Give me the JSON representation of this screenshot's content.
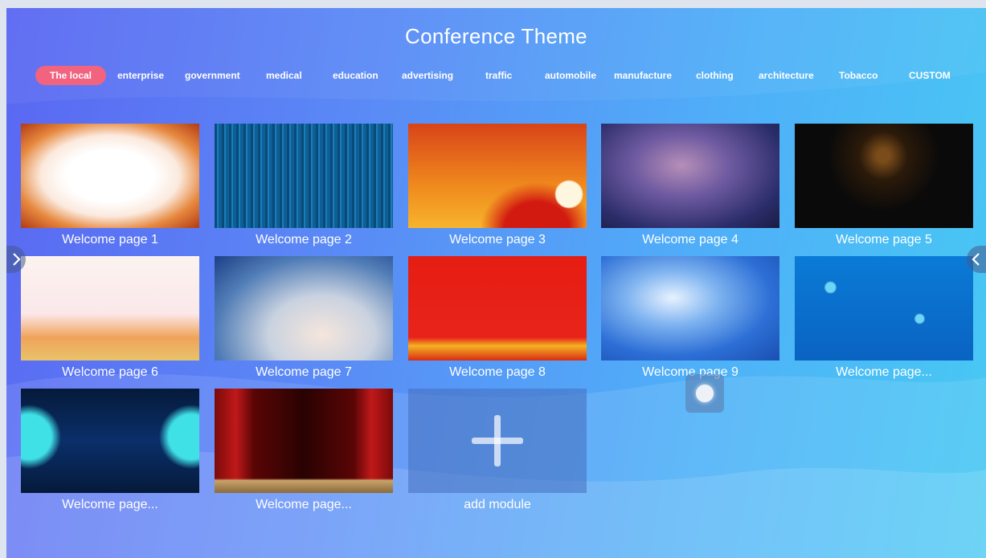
{
  "header": {
    "title": "Conference Theme"
  },
  "categories": [
    {
      "label": "The local",
      "active": true
    },
    {
      "label": "enterprise"
    },
    {
      "label": "government"
    },
    {
      "label": "medical"
    },
    {
      "label": "education"
    },
    {
      "label": "advertising"
    },
    {
      "label": "traffic"
    },
    {
      "label": "automobile"
    },
    {
      "label": "manufacture"
    },
    {
      "label": "clothing"
    },
    {
      "label": "architecture"
    },
    {
      "label": "Tobacco"
    },
    {
      "label": "CUSTOM"
    }
  ],
  "themes": [
    {
      "label": "Welcome page 1"
    },
    {
      "label": "Welcome page 2"
    },
    {
      "label": "Welcome page 3"
    },
    {
      "label": "Welcome page 4"
    },
    {
      "label": "Welcome page 5"
    },
    {
      "label": "Welcome page 6"
    },
    {
      "label": "Welcome page 7"
    },
    {
      "label": "Welcome page 8"
    },
    {
      "label": "Welcome page 9"
    },
    {
      "label": "Welcome page..."
    },
    {
      "label": "Welcome page..."
    },
    {
      "label": "Welcome page..."
    }
  ],
  "add_module": {
    "label": "add module"
  },
  "colors": {
    "active_tab": "#f1637f",
    "background_start": "#5a67f2",
    "background_end": "#47c9f3"
  },
  "icons": {
    "prev": "chevron-right-icon",
    "next": "chevron-left-icon",
    "add": "plus-icon",
    "floating": "assistive-touch-icon"
  }
}
